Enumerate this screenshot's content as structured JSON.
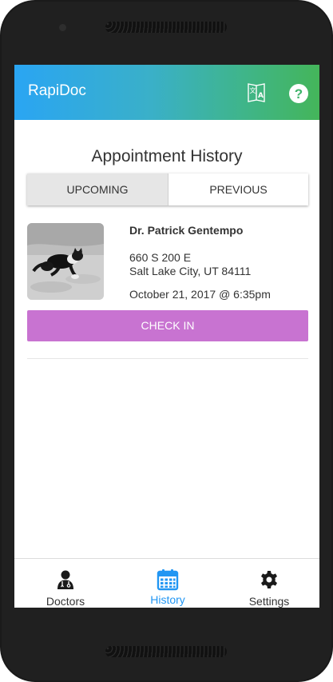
{
  "app": {
    "title": "RapiDoc",
    "gradient_start": "#2aa5f3",
    "gradient_end": "#44b55a"
  },
  "toolbar": {
    "translate_icon": "translate-icon",
    "help_label": "?"
  },
  "page": {
    "title": "Appointment History"
  },
  "tabs": [
    {
      "label": "UPCOMING",
      "selected": true
    },
    {
      "label": "PREVIOUS",
      "selected": false
    }
  ],
  "appointment": {
    "doctor_name": "Dr. Patrick Gentempo",
    "address_line1": "660 S 200 E",
    "address_line2": "Salt Lake City, UT 84111",
    "datetime": "October 21, 2017 @ 6:35pm",
    "checkin_label": "CHECK IN",
    "checkin_color": "#c873d1"
  },
  "bottom_nav": [
    {
      "label": "Doctors",
      "icon": "doctor-icon",
      "active": false
    },
    {
      "label": "History",
      "icon": "calendar-icon",
      "active": true
    },
    {
      "label": "Settings",
      "icon": "gear-icon",
      "active": false
    }
  ],
  "colors": {
    "active_nav": "#2196f3"
  }
}
